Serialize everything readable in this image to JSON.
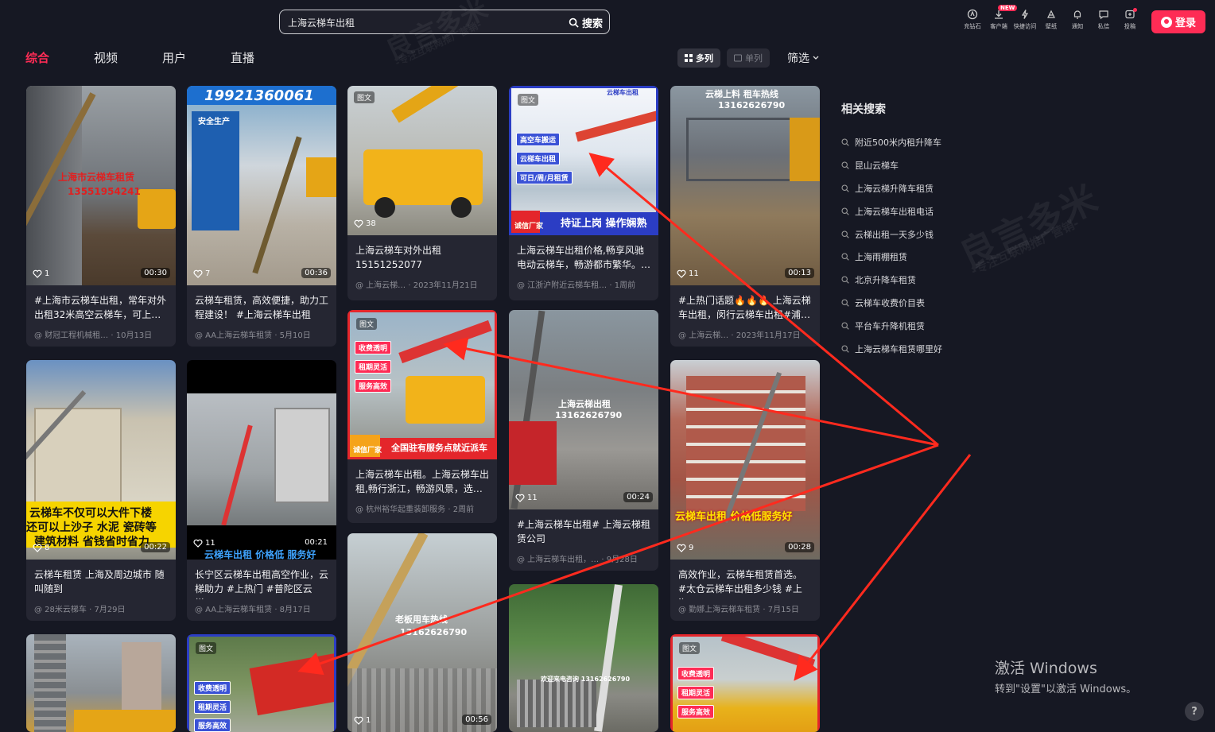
{
  "search": {
    "query": "上海云梯车出租",
    "button_label": "搜索"
  },
  "top_icons": [
    {
      "label": "充钻石",
      "icon": "diamond-icon"
    },
    {
      "label": "客户端",
      "icon": "download-icon",
      "badge": "NEW"
    },
    {
      "label": "快捷访问",
      "icon": "lightning-icon"
    },
    {
      "label": "壁纸",
      "icon": "wallpaper-icon"
    },
    {
      "label": "通知",
      "icon": "bell-icon"
    },
    {
      "label": "私信",
      "icon": "message-icon"
    },
    {
      "label": "投稿",
      "icon": "upload-icon"
    }
  ],
  "login_label": "登录",
  "tabs": [
    "综合",
    "视频",
    "用户",
    "直播"
  ],
  "active_tab": "综合",
  "layout": {
    "multi_label": "多列",
    "single_label": "单列",
    "filter_label": "筛选"
  },
  "related": {
    "title": "相关搜索",
    "items": [
      "附近500米内租升降车",
      "昆山云梯车",
      "上海云梯升降车租赁",
      "上海云梯车出租电话",
      "云梯出租一天多少钱",
      "上海雨棚租赁",
      "北京升降车租赁",
      "云梯车收费价目表",
      "平台车升降机租赁",
      "上海云梯车租赁哪里好"
    ]
  },
  "cards": [
    {
      "title": "#上海市云梯车出租，常年对外出租32米高空云梯车，可上…",
      "author": "@ 财冠工程机械租…",
      "date": "· 10月13日",
      "likes": "1",
      "duration": "00:30",
      "overlay": [
        "上海市云梯车租赁",
        "13551954241"
      ]
    },
    {
      "title": "云梯车租赁，高效便捷，助力工程建设！ #上海云梯车出租 #…",
      "author": "@ AA上海云梯车租赁",
      "date": "· 5月10日",
      "likes": "7",
      "duration": "00:36",
      "overlay": [
        "19921360061",
        "安全生产"
      ]
    },
    {
      "title": "上海云梯车对外出租 15151252077",
      "author": "@ 上海云梯…",
      "date": "· 2023年11月21日",
      "likes": "38",
      "badge": "图文"
    },
    {
      "title": "上海云梯车出租价格,畅享风驰电动云梯车，畅游都市繁华。…",
      "author": "@ 江浙沪附近云梯车租…",
      "date": "· 1周前",
      "badge": "图文",
      "overlay": [
        "云梯车出租",
        "高空车搬运",
        "云梯车出租",
        "可日/周/月租赁",
        "诚信厂家",
        "持证上岗 操作娴熟"
      ]
    },
    {
      "title": "#上热门话题🔥🔥🔥 上海云梯车出租，闵行云梯车出租#浦…",
      "author": "@ 上海云梯…",
      "date": "· 2023年11月17日",
      "likes": "11",
      "duration": "00:13",
      "overlay": [
        "云梯上料 租车热线",
        "13162626790"
      ]
    },
    {
      "title": "云梯车租赁 上海及周边城市 随叫随到",
      "author": "@ 28米云梯车",
      "date": "· 7月29日",
      "likes": "8",
      "duration": "00:22",
      "overlay": [
        "云梯车不仅可以大件下楼",
        "还可以上沙子 水泥 瓷砖等",
        "建筑材料 省钱省时省力"
      ]
    },
    {
      "title": "长宁区云梯车出租高空作业，云梯助力 #上热门 #普陀区云梯…",
      "author": "@ AA上海云梯车租赁",
      "date": "· 8月17日",
      "likes": "11",
      "duration": "00:21",
      "overlay": [
        "云梯车出租 价格低 服务好"
      ]
    },
    {
      "title": "上海云梯车出租。上海云梯车出租,畅行浙江，畅游风景，选…",
      "author": "@ 杭州裕华起重装卸服务",
      "date": "· 2周前",
      "badge": "图文",
      "overlay": [
        "收费透明",
        "租期灵活",
        "服务高效",
        "诚信厂家",
        "全国驻有服务点就近派车"
      ]
    },
    {
      "title": "#上海云梯车出租# 上海云梯租赁公司",
      "author": "@ 上海云梯车出租，…",
      "date": "· 9月28日",
      "likes": "11",
      "duration": "00:24",
      "overlay": [
        "上海云梯出租",
        "13162626790"
      ]
    },
    {
      "title": "高效作业，云梯车租赁首选。 #太仓云梯车出租多少钱 #上海…",
      "author": "@ 勤娜上海云梯车租赁",
      "date": "· 7月15日",
      "likes": "9",
      "duration": "00:28",
      "overlay": [
        "云梯车出租 价格低服务好"
      ]
    },
    {
      "badge": "",
      "overlay": []
    },
    {
      "badge": "图文",
      "overlay": [
        "收费透明",
        "租期灵活",
        "服务高效"
      ]
    },
    {
      "likes": "1",
      "duration": "00:56",
      "overlay": [
        "老板用车热线",
        "13162626790"
      ]
    },
    {
      "overlay": [
        "欢迎来电咨询 13162626790"
      ]
    },
    {
      "badge": "图文",
      "overlay": [
        "收费透明",
        "租期灵活",
        "服务高效"
      ]
    }
  ],
  "watermark": {
    "brand": "良言多米",
    "slogan": "-专注互联网推广营销-"
  },
  "windows_activation": {
    "line1": "激活 Windows",
    "line2": "转到\"设置\"以激活 Windows。"
  },
  "help_label": "?",
  "colors": {
    "accent": "#fe2c55",
    "bg": "#161823",
    "card": "#252632"
  }
}
